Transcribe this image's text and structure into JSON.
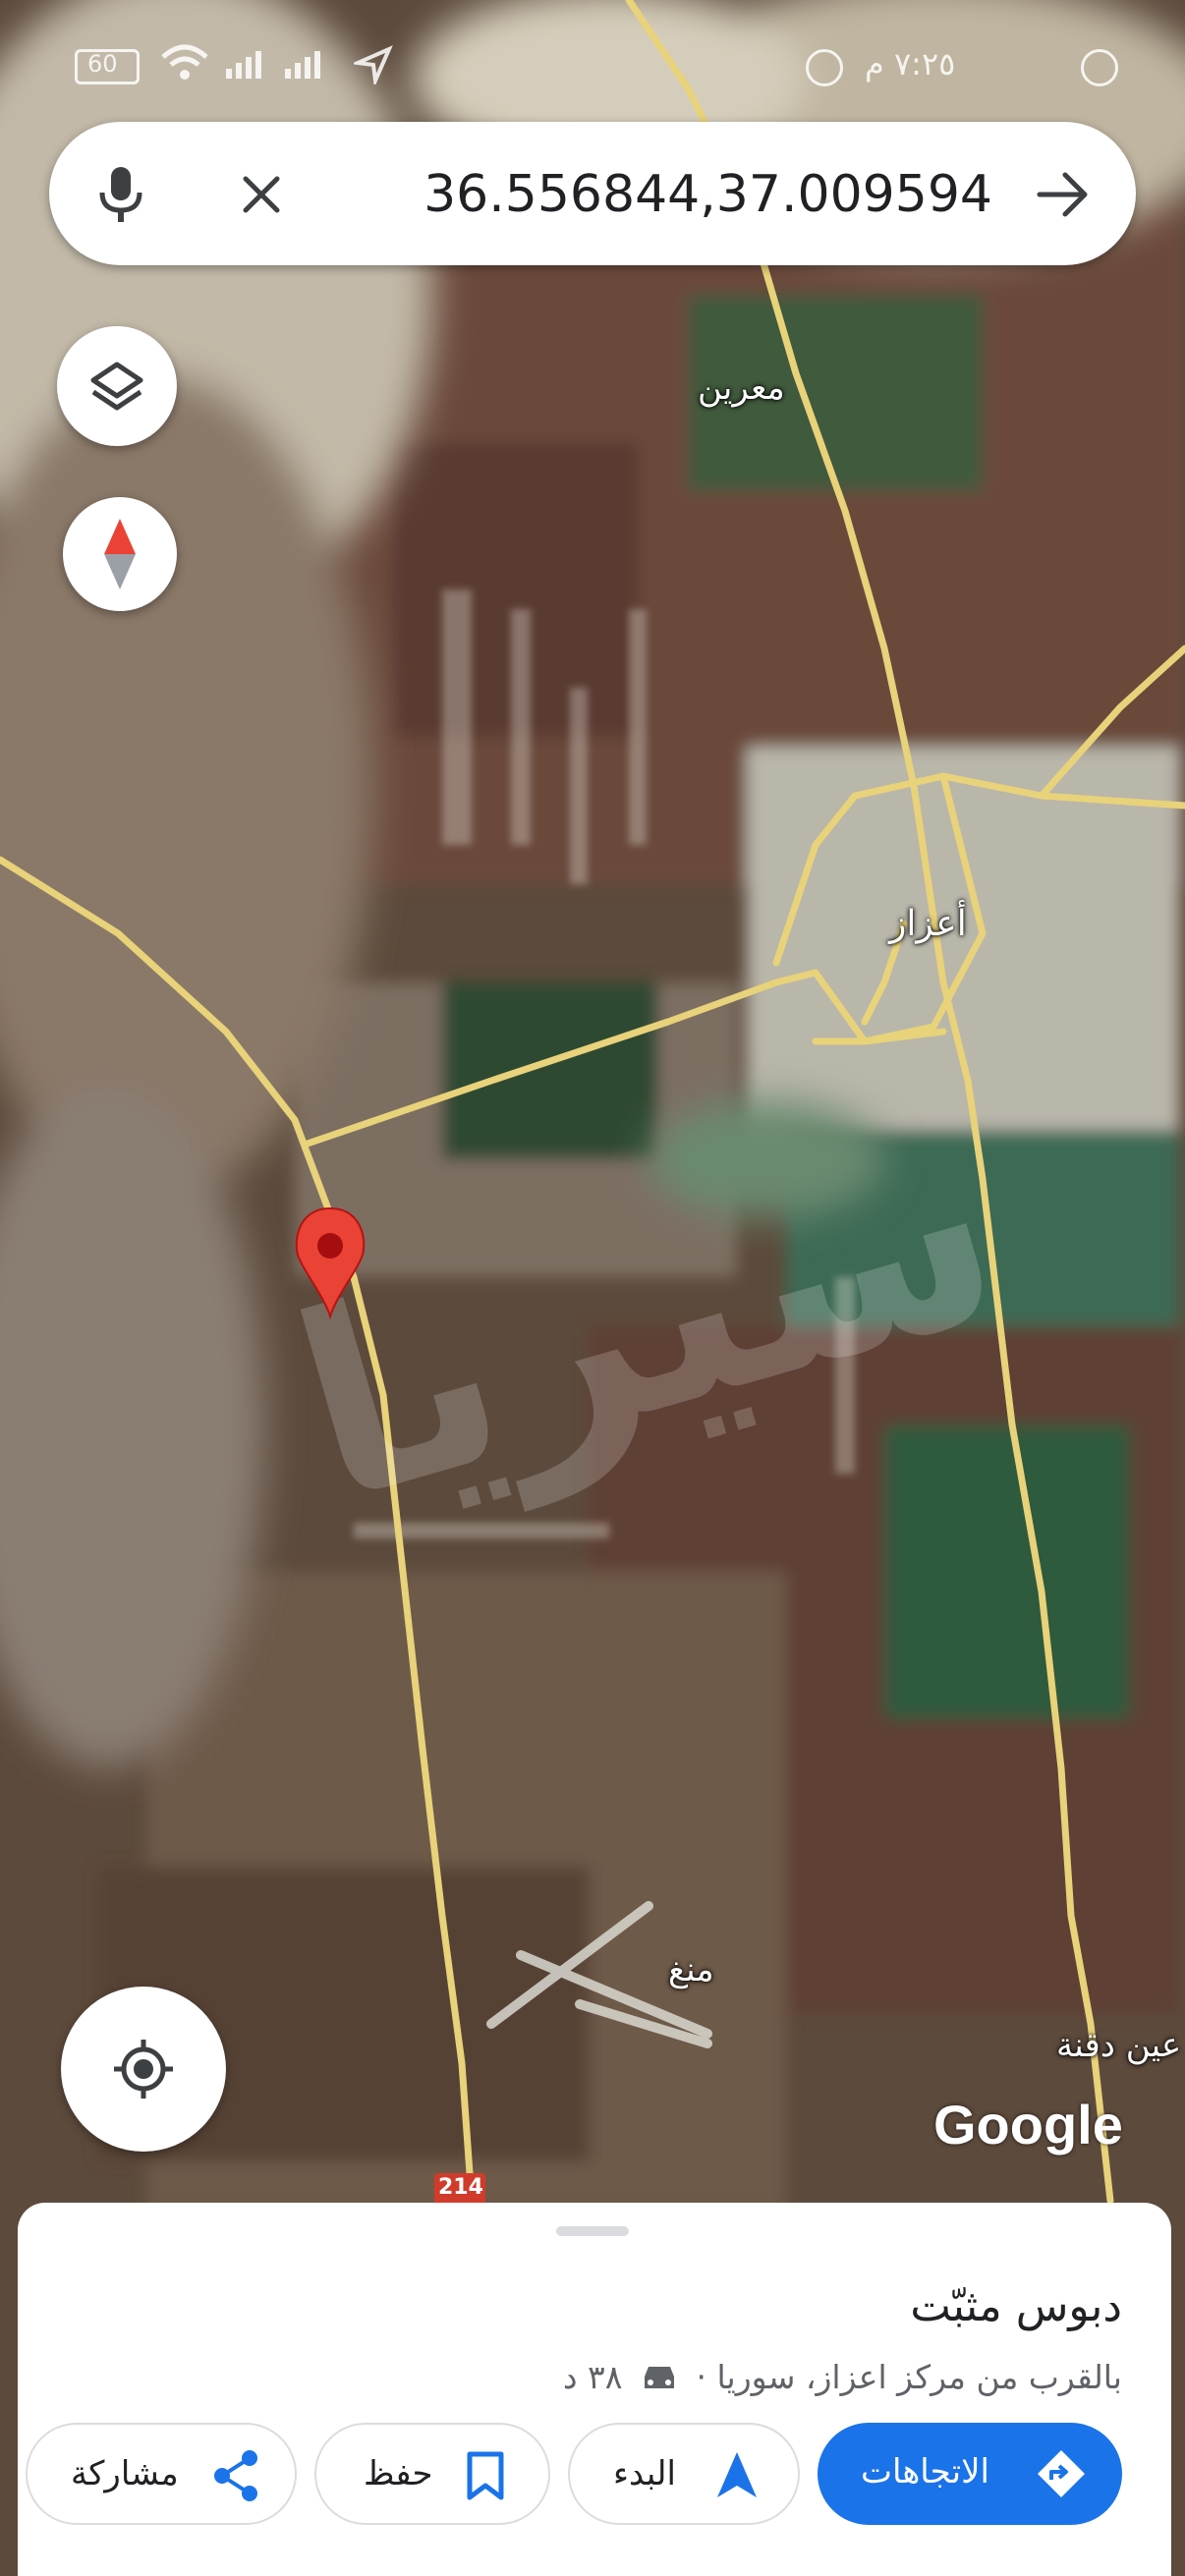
{
  "status_bar": {
    "battery": "60",
    "right_text": "٧:٢٥ م"
  },
  "search": {
    "query": "36.556844,37.009594"
  },
  "map": {
    "labels": {
      "maarin": "معرين",
      "azaz": "أعزاز",
      "menagh": "منغ",
      "ayn_daqna": "عين دقنة"
    },
    "road_number": "214",
    "logo": "Google",
    "road_color": "#e8d27a",
    "pin_color": "#ea4335"
  },
  "sheet": {
    "title": "دبوس مثبّت",
    "subtitle_location": "بالقرب من مركز اعزاز، سوريا ·",
    "drive_time": "٣٨ د",
    "buttons": {
      "directions": "الاتجاهات",
      "start": "البدء",
      "save": "حفظ",
      "share": "مشاركة"
    }
  },
  "colors": {
    "accent": "#1a73e8"
  }
}
